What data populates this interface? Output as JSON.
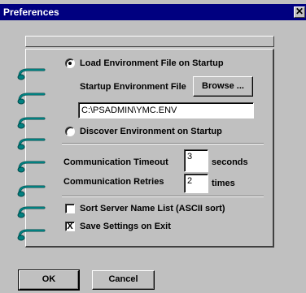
{
  "window": {
    "title": "Preferences",
    "close_glyph": "✕"
  },
  "options": {
    "load_env_label": "Load Environment File on Startup",
    "startup_env_label": "Startup Environment File",
    "browse_label": "Browse ...",
    "env_path_value": "C:\\PSADMIN\\YMC.ENV",
    "discover_env_label": "Discover Environment on Startup",
    "comm_timeout_label": "Communication Timeout",
    "comm_timeout_value": "3",
    "comm_timeout_unit": "seconds",
    "comm_retries_label": "Communication Retries",
    "comm_retries_value": "2",
    "comm_retries_unit": "times",
    "sort_server_label": "Sort Server Name List (ASCII sort)",
    "save_settings_label": "Save Settings on Exit",
    "check_mark": "X"
  },
  "state": {
    "load_env_selected": true,
    "discover_env_selected": false,
    "sort_server_checked": false,
    "save_settings_checked": true
  },
  "buttons": {
    "ok_label": "OK",
    "cancel_label": "Cancel"
  },
  "icons": {
    "binder": "binder-ring-icon"
  },
  "colors": {
    "titlebar": "#000080",
    "face": "#c0c0c0",
    "ring": "#008080"
  }
}
